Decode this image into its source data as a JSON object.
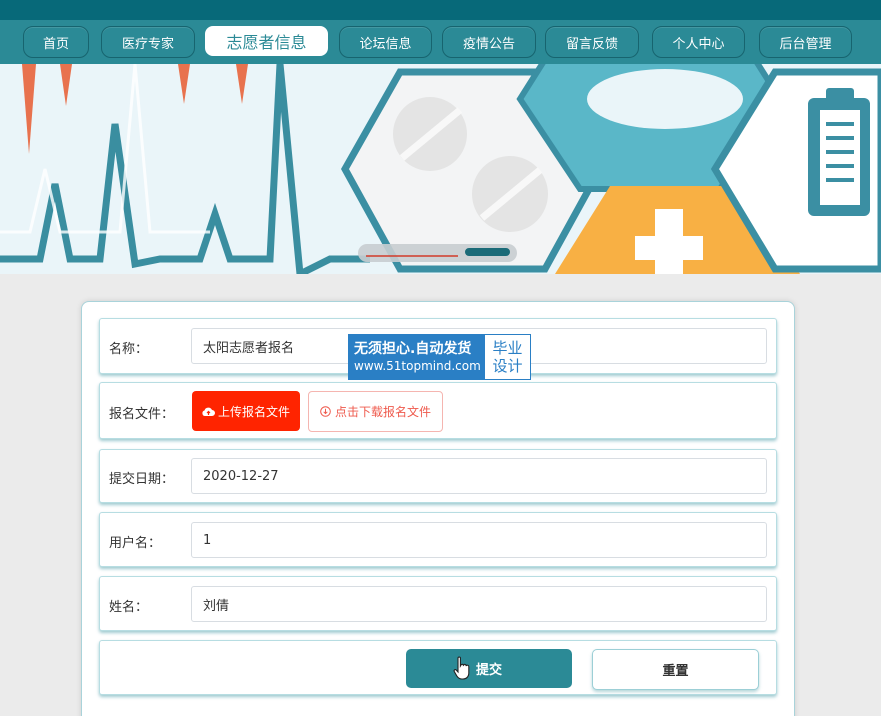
{
  "nav": {
    "items": [
      {
        "label": "首页"
      },
      {
        "label": "医疗专家"
      },
      {
        "label": "志愿者信息"
      },
      {
        "label": "论坛信息"
      },
      {
        "label": "疫情公告"
      },
      {
        "label": "留言反馈"
      },
      {
        "label": "个人中心"
      },
      {
        "label": "后台管理"
      }
    ],
    "active_index": 2
  },
  "form": {
    "name_label": "名称：",
    "name_value": "太阳志愿者报名",
    "file_label": "报名文件：",
    "upload_label": "上传报名文件",
    "download_label": "点击下载报名文件",
    "date_label": "提交日期：",
    "date_value": "2020-12-27",
    "username_label": "用户名：",
    "username_value": "1",
    "realname_label": "姓名：",
    "realname_value": "刘倩",
    "submit_label": "提交",
    "reset_label": "重置"
  },
  "watermark": {
    "line1": "无须担心.自动发货",
    "line2": "www.51topmind.com",
    "side1": "毕业",
    "side2": "设计"
  },
  "colors": {
    "theme": "#2b8a96",
    "topbar": "#076979",
    "upload": "#ff2400",
    "watermark": "#2a7fc5"
  },
  "icons": [
    "cloud-upload-icon",
    "download-icon",
    "hand-pointer-cursor"
  ]
}
